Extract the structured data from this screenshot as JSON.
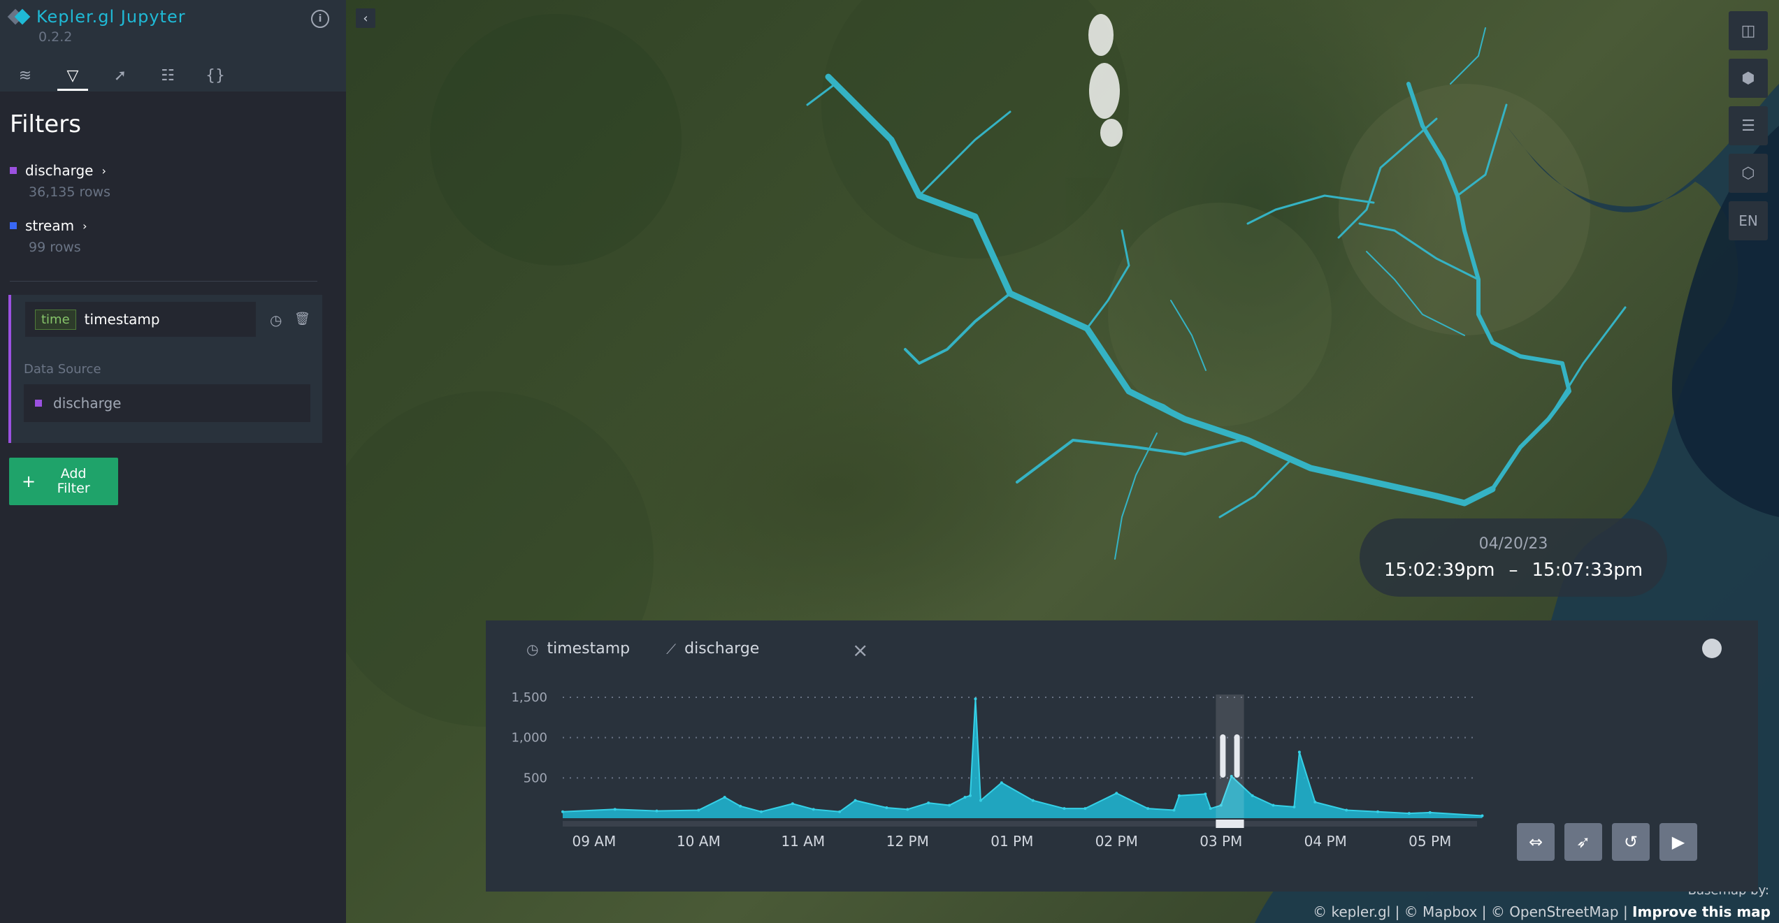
{
  "app": {
    "name": "Kepler.gl Jupyter",
    "version": "0.2.2"
  },
  "side_panel": {
    "title": "Filters",
    "tabs": [
      "layers-icon",
      "filter-icon",
      "interactions-icon",
      "basemap-icon",
      "config-icon"
    ],
    "datasets": [
      {
        "name": "discharge",
        "rows": "36,135 rows",
        "color": "#9b51e0"
      },
      {
        "name": "stream",
        "rows": "99 rows",
        "color": "#3867f5"
      }
    ],
    "filter": {
      "type_tag": "time",
      "field": "timestamp",
      "data_source_label": "Data Source",
      "data_source": "discharge"
    },
    "add_filter_label": "Add Filter"
  },
  "map": {
    "controls": [
      "split-map-icon",
      "3d-map-icon",
      "legend-icon",
      "draw-icon"
    ],
    "language": "EN",
    "tooltip": {
      "date": "04/20/23",
      "start": "15:02:39pm",
      "separator": "–",
      "end": "15:07:33pm"
    },
    "basemap_by": "Basemap by:",
    "attribution": "© kepler.gl | © Mapbox | © OpenStreetMap | ",
    "improve": "Improve this map"
  },
  "time_widget": {
    "field": "timestamp",
    "y_field": "discharge",
    "buttons": [
      "expand-icon",
      "animation-icon",
      "reset-icon",
      "play-icon"
    ]
  },
  "chart_data": {
    "type": "line",
    "title": "",
    "xlabel": "",
    "ylabel": "",
    "x_ticks": [
      "09 AM",
      "10 AM",
      "11 AM",
      "12 PM",
      "01 PM",
      "02 PM",
      "03 PM",
      "04 PM",
      "05 PM"
    ],
    "y_ticks": [
      500,
      1000,
      1500
    ],
    "ylim": [
      0,
      1500
    ],
    "x_hours": [
      8.7,
      9.2,
      9.6,
      10.0,
      10.25,
      10.4,
      10.6,
      10.9,
      11.1,
      11.35,
      11.5,
      11.8,
      12.0,
      12.2,
      12.4,
      12.55,
      12.6,
      12.65,
      12.7,
      12.9,
      13.2,
      13.5,
      13.7,
      14.0,
      14.3,
      14.55,
      14.6,
      14.85,
      14.9,
      15.0,
      15.1,
      15.3,
      15.5,
      15.7,
      15.75,
      15.9,
      16.2,
      16.5,
      16.8,
      17.0,
      17.5
    ],
    "series": [
      {
        "values": [
          80,
          110,
          90,
          100,
          260,
          150,
          80,
          180,
          110,
          80,
          220,
          130,
          110,
          190,
          160,
          260,
          280,
          1480,
          220,
          440,
          220,
          120,
          120,
          310,
          120,
          100,
          280,
          300,
          120,
          160,
          520,
          280,
          160,
          140,
          820,
          200,
          100,
          80,
          60,
          70,
          30
        ]
      }
    ],
    "selection_range": [
      "15:02:39pm",
      "15:07:33pm"
    ]
  }
}
